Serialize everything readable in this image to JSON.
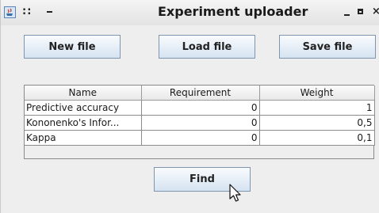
{
  "window": {
    "title": "Experiment uploader",
    "menu_glyph": "::",
    "close_glyph": "×"
  },
  "toolbar": {
    "new_label": "New file",
    "load_label": "Load file",
    "save_label": "Save file"
  },
  "table": {
    "columns": [
      "Name",
      "Requirement",
      "Weight"
    ],
    "rows": [
      {
        "name": "Predictive accuracy",
        "requirement": "0",
        "weight": "1"
      },
      {
        "name": "Kononenko's Infor...",
        "requirement": "0",
        "weight": "0,5"
      },
      {
        "name": "Kappa",
        "requirement": "0",
        "weight": "0,1"
      }
    ]
  },
  "actions": {
    "find_label": "Find"
  },
  "colors": {
    "button_top": "#f9fbfd",
    "button_bottom": "#d5e3f1",
    "button_border": "#7e95ad",
    "window_bg": "#eeeeee"
  },
  "icons": [
    "java-app-icon",
    "window-menu-icon",
    "minimize-icon",
    "maximize-icon",
    "close-icon",
    "mouse-pointer-icon"
  ]
}
